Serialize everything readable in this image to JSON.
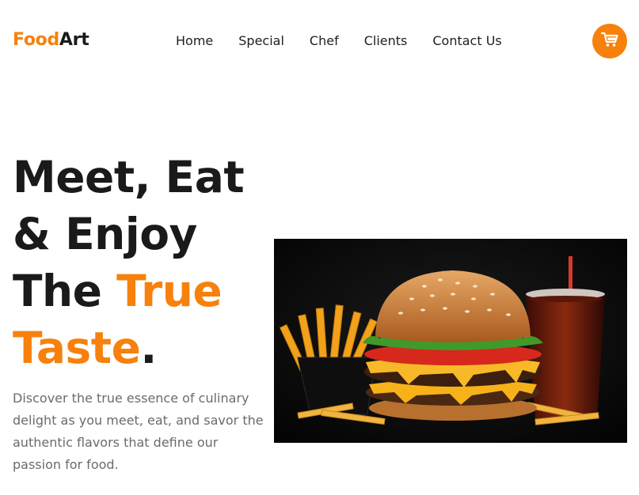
{
  "logo": {
    "part1": "Food",
    "part2": "Art"
  },
  "nav": {
    "items": [
      "Home",
      "Special",
      "Chef",
      "Clients",
      "Contact Us"
    ]
  },
  "cart": {
    "icon": "cart-icon"
  },
  "hero": {
    "line1": "Meet, Eat",
    "line2": "& Enjoy",
    "line3_a": "The ",
    "line3_b": "True",
    "line4_a": "Taste",
    "line4_b": ".",
    "description": "Discover the true essence of culinary delight as you meet, eat, and savor the authentic flavors that define our passion for food."
  },
  "colors": {
    "accent": "#f7810c",
    "text": "#1a1a1a",
    "muted": "#6b6b6b"
  }
}
